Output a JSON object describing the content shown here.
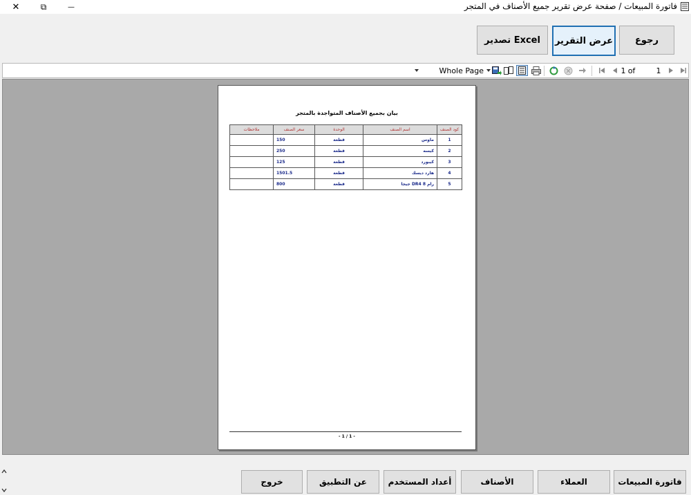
{
  "window": {
    "title": "فاتورة المبيعات / صفحة عرض تقرير جميع الأصناف في المتجر",
    "close_glyph": "✕",
    "restore_glyph": "⧉",
    "minimize_glyph": "—"
  },
  "top_buttons": {
    "back": "رجوع",
    "show_report": "عرض التقرير",
    "export_excel": "تصدير Excel"
  },
  "toolbar": {
    "page_total": "1",
    "of_label": "of",
    "page_current": "1",
    "zoom_value": "Whole Page"
  },
  "report": {
    "title": "بيان بجميع الأصناف المتواجدة بالمتجر",
    "columns": [
      "كود الصنف",
      "اسم الصنف",
      "الوحدة",
      "سعر الصنف",
      "ملاحظات"
    ],
    "rows": [
      [
        "1",
        "ماوس",
        "قطعة",
        "150",
        ""
      ],
      [
        "2",
        "كيسه",
        "قطعة",
        "250",
        ""
      ],
      [
        "3",
        "كيبورد",
        "قطعة",
        "125",
        ""
      ],
      [
        "4",
        "هارد ديسك",
        "قطعة",
        "1501.5",
        ""
      ],
      [
        "5",
        "رام DR4 8 جيجا",
        "قطعة",
        "800",
        ""
      ]
    ],
    "page_footer": "- 1 / 1 -"
  },
  "bottom_buttons": {
    "sales_invoice": "فاتورة المبيعات",
    "customers": "العملاء",
    "items": "الأصناف",
    "user_settings": "أعداد المستخدم",
    "about": "عن التطبيق",
    "exit": "خروج"
  },
  "colors": {
    "focus_border": "#1f6fb2",
    "header_text": "#b03030",
    "cell_text": "#1a2a8a",
    "viewer_bg": "#a9a9a9"
  }
}
